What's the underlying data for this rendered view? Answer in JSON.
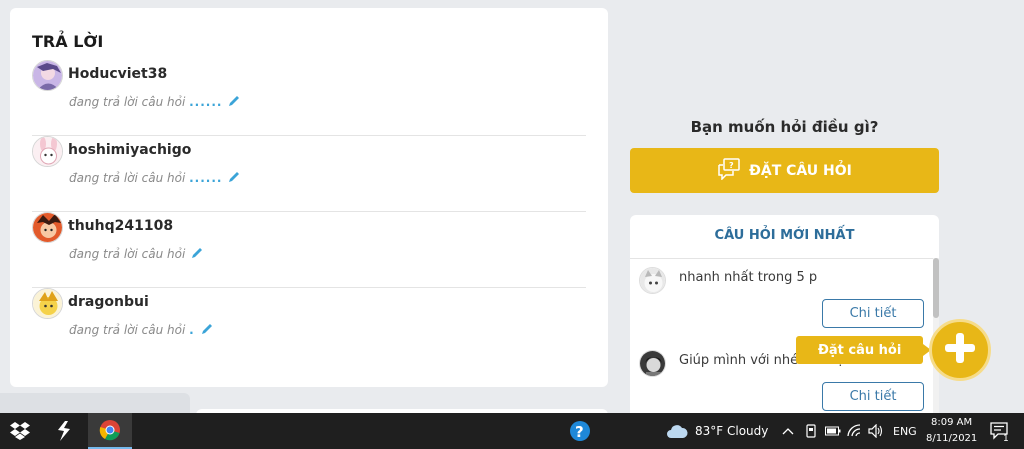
{
  "answers": {
    "title": "TRẢ LỜI",
    "items": [
      {
        "username": "Hoducviet38",
        "status": "đang trả lời câu hỏi",
        "dots": "......"
      },
      {
        "username": "hoshimiyachigo",
        "status": "đang trả lời câu hỏi",
        "dots": "......"
      },
      {
        "username": "thuhq241108",
        "status": "đang trả lời câu hỏi",
        "dots": ""
      },
      {
        "username": "dragonbui",
        "status": "đang trả lời câu hỏi",
        "dots": "."
      }
    ]
  },
  "ask": {
    "heading": "Bạn muốn hỏi điều gì?",
    "button_label": "ĐẶT CÂU HỎI"
  },
  "latest": {
    "title": "CÂU HỎI MỚI NHẤT",
    "items": [
      {
        "text": "nhanh nhất trong 5 p",
        "button": "Chi tiết"
      },
      {
        "text": "Giúp mình với nhé các bạn",
        "button": "Chi tiết"
      }
    ]
  },
  "fab": {
    "tooltip": "Đặt câu hỏi"
  },
  "taskbar": {
    "weather": "83°F  Cloudy",
    "language": "ENG",
    "time": "8:09 AM",
    "date": "8/11/2021",
    "notification_count": "1"
  },
  "colors": {
    "accent": "#e8b717",
    "link": "#3a79a8",
    "title_blue": "#2d6d9a",
    "taskbar": "#1f1f1f"
  }
}
